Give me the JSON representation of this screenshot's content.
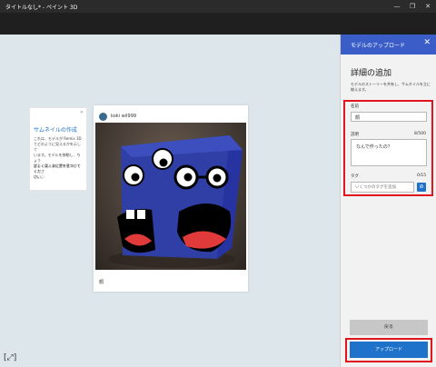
{
  "window": {
    "title": "タイトルなし* - ペイント 3D",
    "minimize": "—",
    "maximize": "❐",
    "close": "✕"
  },
  "tip": {
    "close": "✕",
    "title": "サムネイルの作成",
    "body1": "これは、モデルが Remix 3D\nでどのように見えるかを示して\nいます。モデルを移動し、ちょう\nどよく見える位置を見つけてくだ\nさい。",
    "body2": "詳しくは、次にアクセスしてくださ\nい。 ⛶"
  },
  "preview_card": {
    "username": "koki wil999",
    "model_name": "顔"
  },
  "panel": {
    "header": "モデルのアップロード",
    "close": "✕",
    "heading": "詳細の追加",
    "description": "モデルのストーリーを共有し、サムネイルを立に揃えます。",
    "name_label": "名前",
    "name_value": "顔",
    "desc_label": "説明",
    "desc_count": "8/500",
    "desc_value": "なんで作ったの？",
    "tags_label": "タグ",
    "tags_count": "0/15",
    "tags_placeholder": "いくつかのタグを追加",
    "add_tag_icon": "⊘",
    "back_button": "戻る",
    "upload_button": "アップロード"
  },
  "accent_colors": {
    "panel_header": "#3a5dc8",
    "primary_button": "#1e72c9",
    "highlight": "#e0141c"
  }
}
